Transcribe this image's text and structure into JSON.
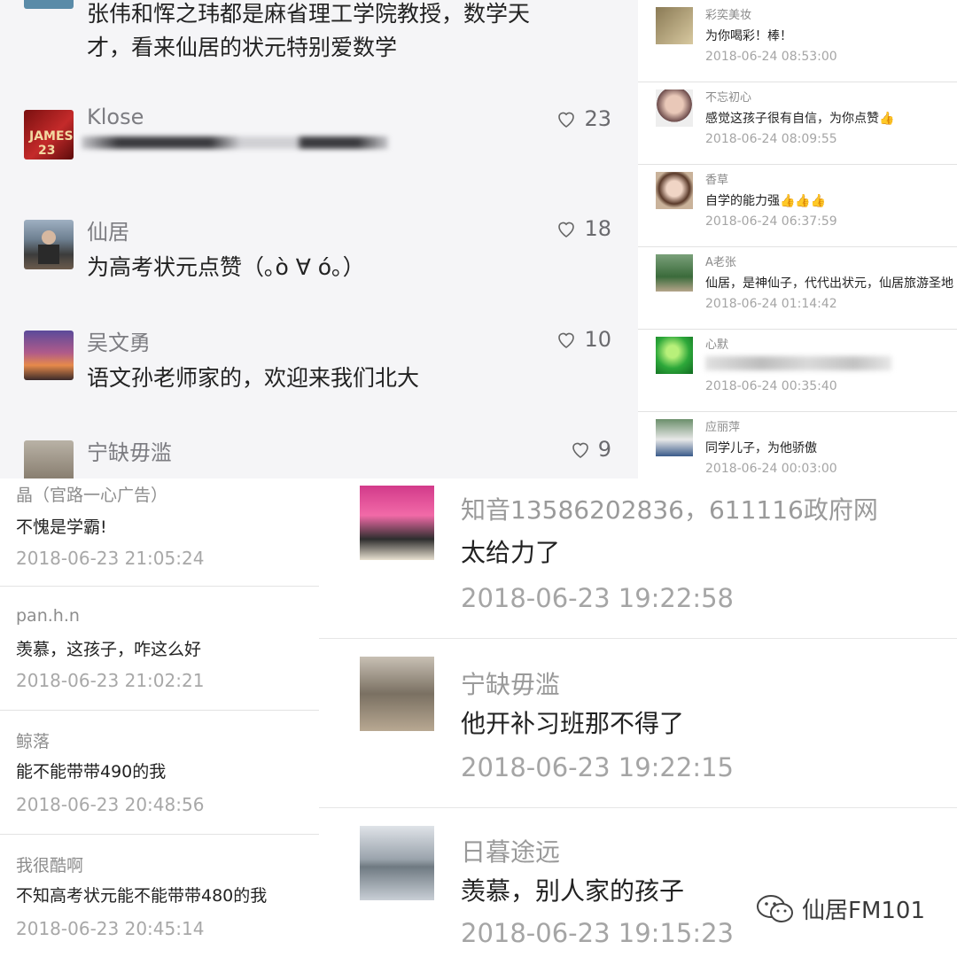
{
  "panel_a": {
    "top_comment": {
      "text_line1": "张伟和恽之玮都是麻省理工学院教授，数学天",
      "text_line2": "才，看来仙居的状元特别爱数学"
    },
    "comments": [
      {
        "name": "Klose",
        "text": "",
        "likes": "23"
      },
      {
        "name": "仙居",
        "text": "为高考状元点赞（｡ò ∀ ó｡）",
        "likes": "18"
      },
      {
        "name": "吴文勇",
        "text": "语文孙老师家的，欢迎来我们北大",
        "likes": "10"
      },
      {
        "name": "宁缺毋滥",
        "text": "",
        "likes": "9"
      }
    ]
  },
  "panel_b": {
    "comments": [
      {
        "name": "彩奕美妆",
        "text": "为你喝彩！棒！",
        "time": "2018-06-24 08:53:00"
      },
      {
        "name": "不忘初心",
        "text": "感觉这孩子很有自信，为你点赞👍",
        "time": "2018-06-24 08:09:55"
      },
      {
        "name": "香草",
        "text": "自学的能力强👍👍👍",
        "time": "2018-06-24 06:37:59"
      },
      {
        "name": "A老张",
        "text": "仙居，是神仙子，代代出状元，仙居旅游圣地",
        "time": "2018-06-24 01:14:42"
      },
      {
        "name": "心默",
        "text": "",
        "time": "2018-06-24 00:35:40"
      },
      {
        "name": "应丽萍",
        "text": "同学儿子，为他骄傲",
        "time": "2018-06-24 00:03:00"
      }
    ]
  },
  "panel_c": {
    "comments": [
      {
        "name": "晶（官路一心广告）",
        "text": "不愧是学霸!",
        "time": "2018-06-23 21:05:24"
      },
      {
        "name": "pan.h.n",
        "text": "羡慕，这孩子，咋这么好",
        "time": "2018-06-23 21:02:21"
      },
      {
        "name": "鲸落",
        "text": "能不能带带490的我",
        "time": "2018-06-23 20:48:56"
      },
      {
        "name": "我很酷啊",
        "text": "不知高考状元能不能带带480的我",
        "time": "2018-06-23 20:45:14"
      }
    ]
  },
  "panel_d": {
    "comments": [
      {
        "name": "知音13586202836，611116政府网",
        "text": "太给力了",
        "time": "2018-06-23 19:22:58"
      },
      {
        "name": "宁缺毋滥",
        "text": "他开补习班那不得了",
        "time": "2018-06-23 19:22:15"
      },
      {
        "name": "日暮途远",
        "text": "羡慕，别人家的孩子",
        "time": "2018-06-23 19:15:23"
      }
    ]
  },
  "watermark": {
    "label": "仙居FM101",
    "icon": "wechat-icon"
  },
  "colors": {
    "accent_bg": "#f5f5f7",
    "name_gray": "#8a8a8a",
    "time_gray": "#a5a5a5"
  }
}
